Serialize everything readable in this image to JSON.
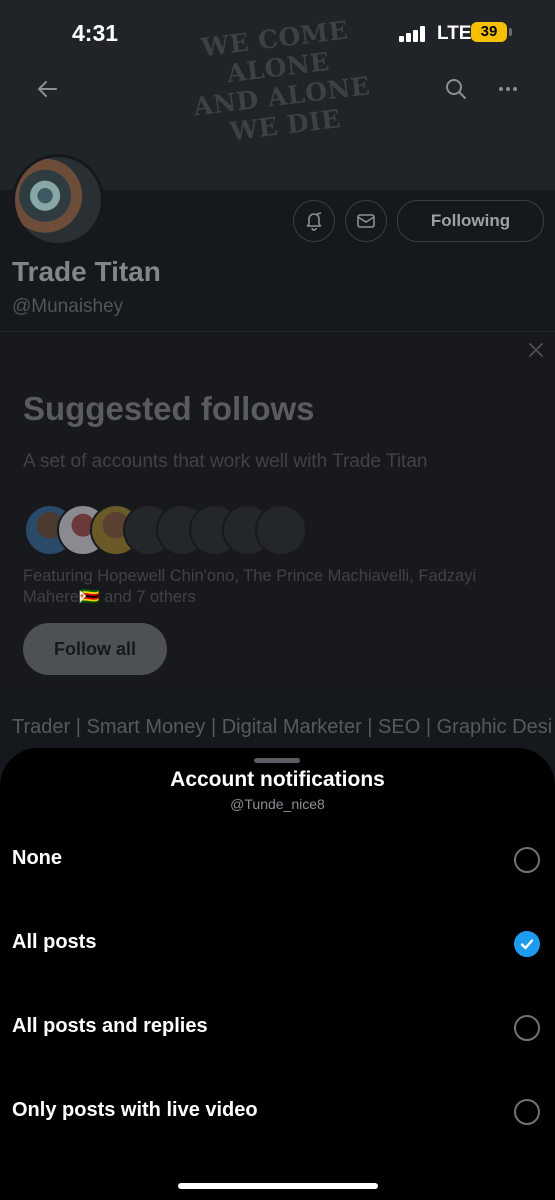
{
  "status_bar": {
    "time": "4:31",
    "network": "LTE",
    "battery": "39"
  },
  "banner": {
    "art_lines": [
      "WE COME",
      "ALONE",
      "AND ALONE",
      "WE DIE"
    ]
  },
  "profile": {
    "name": "Trade Titan",
    "handle": "@Munaishey",
    "following_label": "Following",
    "bio": "Trader | Smart Money | Digital Marketer | SEO | Graphic Designer | Prefer Partnerships"
  },
  "suggested": {
    "title": "Suggested follows",
    "subtitle": "A set of accounts that work well with Trade Titan",
    "featuring_line1": "Featuring Hopewell Chin'ono, The Prince Machiavelli, Fadzayi",
    "featuring_line2": "Mahere🇿🇼 and 7 others",
    "follow_all_label": "Follow all"
  },
  "sheet": {
    "title": "Account notifications",
    "subtitle": "@Tunde_nice8",
    "options": [
      {
        "label": "None",
        "selected": false
      },
      {
        "label": "All posts",
        "selected": true
      },
      {
        "label": "All posts and replies",
        "selected": false
      },
      {
        "label": "Only posts with live video",
        "selected": false
      }
    ]
  },
  "colors": {
    "accent": "#1d9bf0",
    "sheet_bg": "#000000",
    "dimmed_bg": "#15181c",
    "battery": "#f6c000"
  },
  "icons": [
    "back-arrow-icon",
    "search-icon",
    "more-icon",
    "notification-bell-icon",
    "mail-icon",
    "close-icon",
    "checkmark-icon"
  ]
}
